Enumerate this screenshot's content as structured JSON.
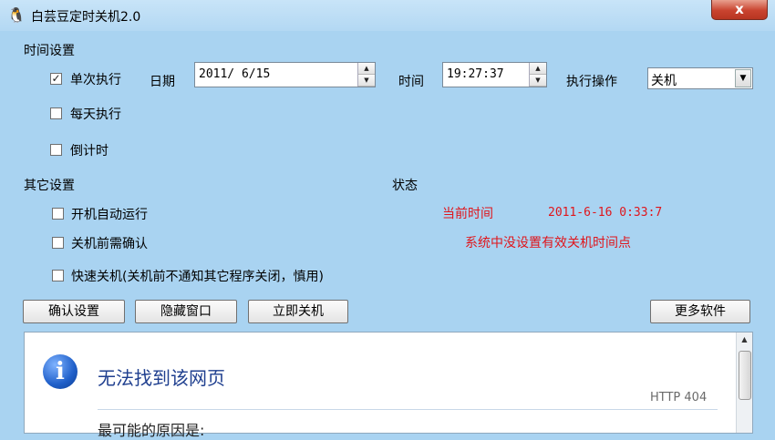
{
  "window": {
    "title": "白芸豆定时关机2.0",
    "close_label": "x"
  },
  "time_settings": {
    "section_label": "时间设置",
    "once": {
      "label": "单次执行",
      "checked": true,
      "mark": "✓"
    },
    "daily": {
      "label": "每天执行",
      "checked": false
    },
    "countdown": {
      "label": "倒计时",
      "checked": false
    },
    "date_label": "日期",
    "date_value": "2011/ 6/15",
    "time_label": "时间",
    "time_value": "19:27:37",
    "action_label": "执行操作",
    "action_value": "关机"
  },
  "other_settings": {
    "section_label": "其它设置",
    "autostart": {
      "label": "开机自动运行",
      "checked": false
    },
    "confirm": {
      "label": "关机前需确认",
      "checked": false
    },
    "fast": {
      "label": "快速关机(关机前不通知其它程序关闭，慎用)",
      "checked": false
    }
  },
  "status": {
    "section_label": "状态",
    "current_time_label": "当前时间",
    "current_time_value": "2011-6-16 0:33:7",
    "message": "系统中没设置有效关机时间点"
  },
  "buttons": {
    "confirm": "确认设置",
    "hide": "隐藏窗口",
    "shutdown_now": "立即关机",
    "more_software": "更多软件"
  },
  "browser": {
    "icon_glyph": "i",
    "error_title": "无法找到该网页",
    "error_code": "HTTP 404",
    "reason_heading": "最可能的原因是:"
  },
  "colors": {
    "window_bg": "#a9d3f1",
    "status_red": "#e0151b",
    "close_red": "#c9432f"
  }
}
